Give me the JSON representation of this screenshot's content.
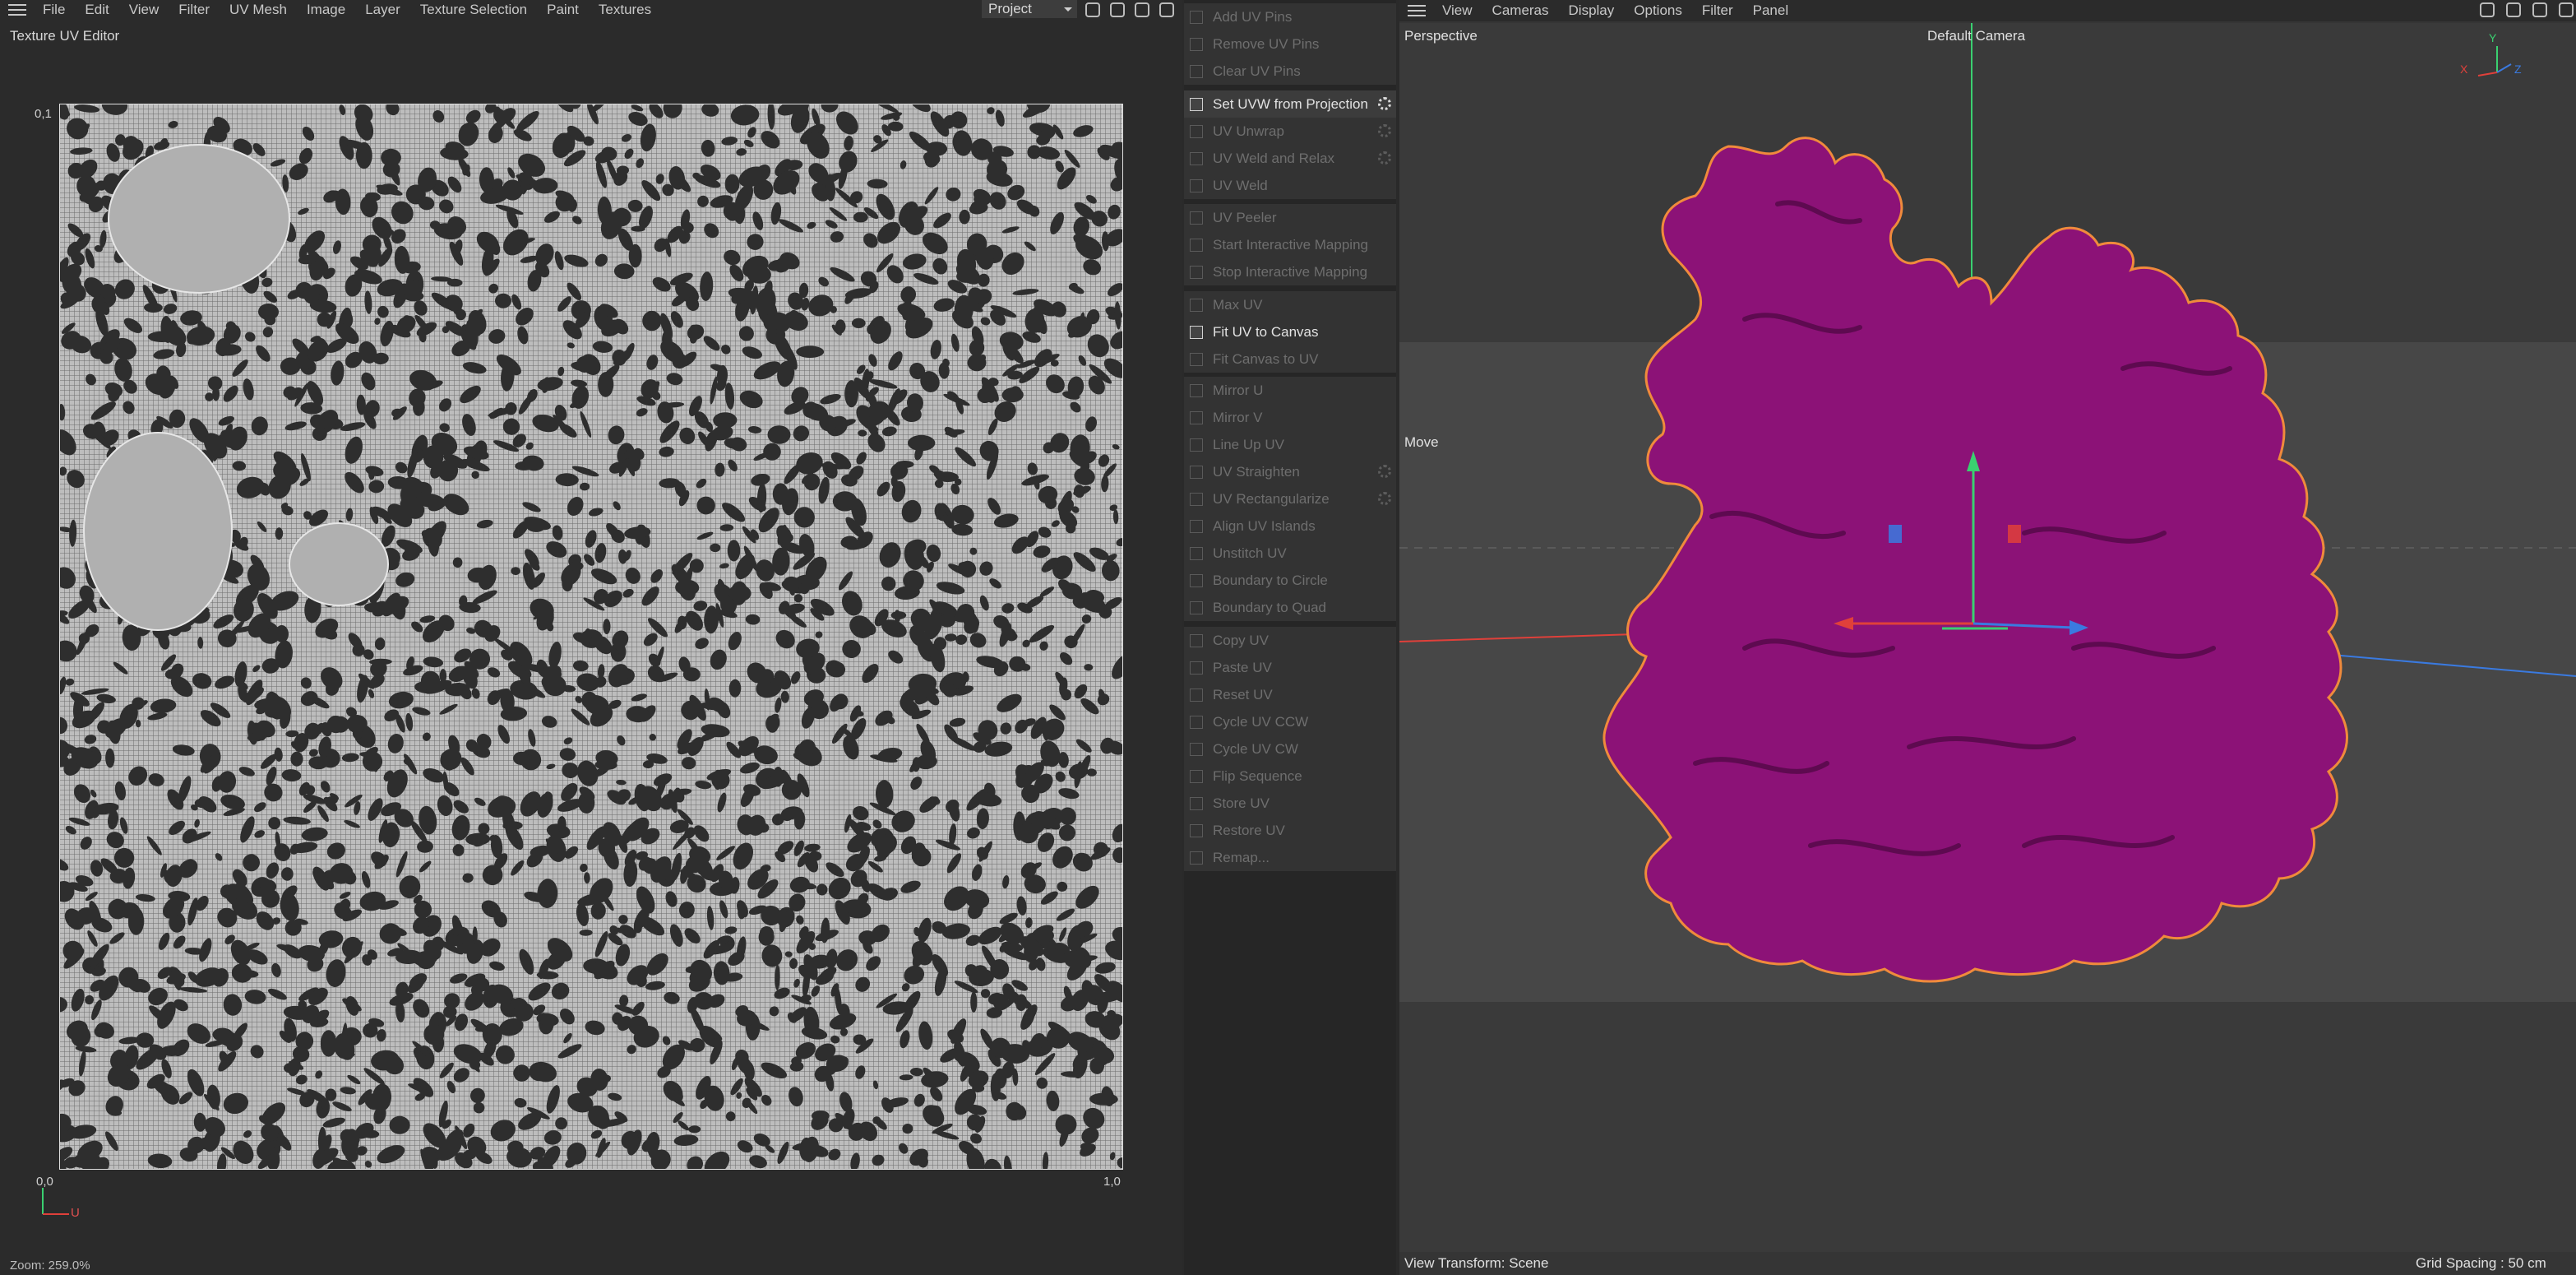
{
  "uv_editor": {
    "menu": [
      "File",
      "Edit",
      "View",
      "Filter",
      "UV Mesh",
      "Image",
      "Layer",
      "Texture Selection",
      "Paint",
      "Textures"
    ],
    "project_select": "Project",
    "title": "Texture UV Editor",
    "label_top_left": "0,1",
    "label_bottom_left": "0,0",
    "label_bottom_right": "1,0",
    "axis_u": "U",
    "zoom": "Zoom: 259.0%"
  },
  "commands": {
    "group1": [
      {
        "label": "Add UV Pins",
        "enabled": false,
        "gear": false
      },
      {
        "label": "Remove UV Pins",
        "enabled": false,
        "gear": false
      },
      {
        "label": "Clear UV Pins",
        "enabled": false,
        "gear": false
      }
    ],
    "group2": [
      {
        "label": "Set UVW from Projection",
        "enabled": true,
        "gear": true
      },
      {
        "label": "UV Unwrap",
        "enabled": false,
        "gear": true
      },
      {
        "label": "UV Weld and Relax",
        "enabled": false,
        "gear": true
      },
      {
        "label": "UV Weld",
        "enabled": false,
        "gear": false
      }
    ],
    "group3": [
      {
        "label": "UV Peeler",
        "enabled": false,
        "gear": false
      },
      {
        "label": "Start Interactive Mapping",
        "enabled": false,
        "gear": false
      },
      {
        "label": "Stop Interactive Mapping",
        "enabled": false,
        "gear": false
      }
    ],
    "group4": [
      {
        "label": "Max UV",
        "enabled": false,
        "gear": false
      },
      {
        "label": "Fit UV to Canvas",
        "enabled": true,
        "gear": false
      },
      {
        "label": "Fit Canvas to UV",
        "enabled": false,
        "gear": false
      }
    ],
    "group5": [
      {
        "label": "Mirror U",
        "enabled": false,
        "gear": false
      },
      {
        "label": "Mirror V",
        "enabled": false,
        "gear": false
      },
      {
        "label": "Line Up UV",
        "enabled": false,
        "gear": false
      },
      {
        "label": "UV Straighten",
        "enabled": false,
        "gear": true
      },
      {
        "label": "UV Rectangularize",
        "enabled": false,
        "gear": true
      },
      {
        "label": "Align UV Islands",
        "enabled": false,
        "gear": false
      },
      {
        "label": "Unstitch UV",
        "enabled": false,
        "gear": false
      },
      {
        "label": "Boundary to Circle",
        "enabled": false,
        "gear": false
      },
      {
        "label": "Boundary to Quad",
        "enabled": false,
        "gear": false
      }
    ],
    "group6": [
      {
        "label": "Copy UV",
        "enabled": false,
        "gear": false
      },
      {
        "label": "Paste UV",
        "enabled": false,
        "gear": false
      },
      {
        "label": "Reset UV",
        "enabled": false,
        "gear": false
      },
      {
        "label": "Cycle UV CCW",
        "enabled": false,
        "gear": false
      },
      {
        "label": "Cycle UV CW",
        "enabled": false,
        "gear": false
      },
      {
        "label": "Flip Sequence",
        "enabled": false,
        "gear": false
      },
      {
        "label": "Store UV",
        "enabled": false,
        "gear": false
      },
      {
        "label": "Restore UV",
        "enabled": false,
        "gear": false
      },
      {
        "label": "Remap...",
        "enabled": false,
        "gear": false
      }
    ]
  },
  "viewport": {
    "menu": [
      "View",
      "Cameras",
      "Display",
      "Options",
      "Filter",
      "Panel"
    ],
    "view_name": "Perspective",
    "camera": "Default Camera",
    "tool": "Move",
    "view_transform": "View Transform: Scene",
    "grid_spacing": "Grid Spacing : 50 cm",
    "axis_labels": [
      "X",
      "Y",
      "Z"
    ],
    "colors": {
      "object": "#8c1277",
      "object_outline": "#f08a3c",
      "x_axis": "#e0403a",
      "y_axis": "#3ad070",
      "z_axis": "#3a7ae0"
    }
  }
}
